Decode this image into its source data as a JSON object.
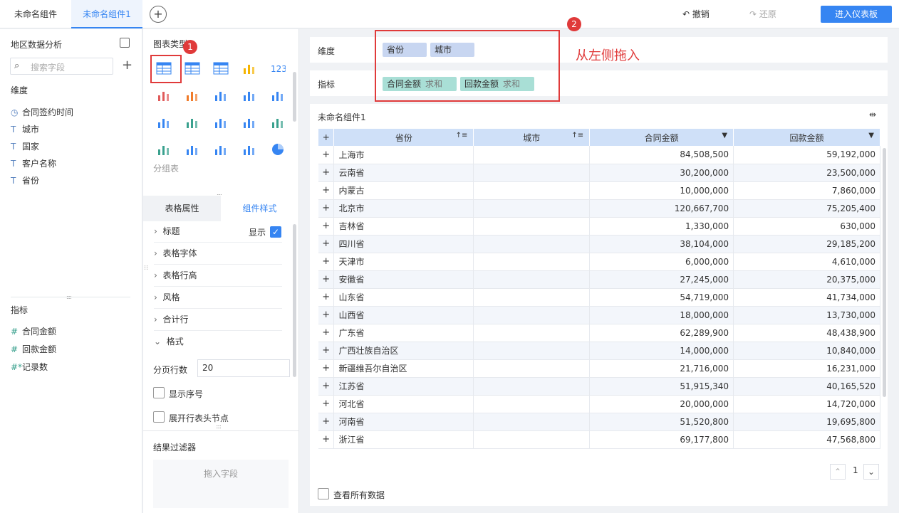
{
  "tabs": [
    "未命名组件",
    "未命名组件1"
  ],
  "toolbar": {
    "undo": "撤销",
    "redo": "还原",
    "enter": "进入仪表板"
  },
  "left": {
    "dataset": "地区数据分析",
    "search_placeholder": "搜索字段",
    "dim_title": "维度",
    "dimensions": [
      {
        "icon": "clock-icon",
        "label": "合同签约时间"
      },
      {
        "icon": "text-icon",
        "label": "城市"
      },
      {
        "icon": "text-icon",
        "label": "国家"
      },
      {
        "icon": "text-icon",
        "label": "客户名称"
      },
      {
        "icon": "text-icon",
        "label": "省份"
      }
    ],
    "ind_title": "指标",
    "indicators": [
      {
        "icon": "hash-icon",
        "label": "合同金额"
      },
      {
        "icon": "hash-icon",
        "label": "回款金额"
      },
      {
        "icon": "hash-star-icon",
        "label": "记录数"
      }
    ]
  },
  "mid": {
    "chart_type_title": "图表类型",
    "group_table_label": "分组表",
    "tabs": [
      "表格属性",
      "组件样式"
    ],
    "props": [
      "标题",
      "表格字体",
      "表格行高",
      "风格",
      "合计行",
      "格式"
    ],
    "show_label": "显示",
    "page_rows_label": "分页行数",
    "page_rows_value": "20",
    "show_index": "显示序号",
    "expand_header": "展开行表头节点",
    "filter_title": "结果过滤器",
    "drop_field": "拖入字段"
  },
  "main": {
    "dim_label": "维度",
    "ind_label": "指标",
    "dim_pills": [
      "省份",
      "城市"
    ],
    "ind_pills": [
      {
        "name": "合同金额",
        "agg": "求和"
      },
      {
        "name": "回款金额",
        "agg": "求和"
      }
    ],
    "annotation": "从左侧拖入",
    "badge1": "1",
    "badge2": "2",
    "component_title": "未命名组件1",
    "columns": [
      "省份",
      "城市",
      "合同金额",
      "回款金额"
    ],
    "rows": [
      [
        "上海市",
        "84,508,500",
        "59,192,000"
      ],
      [
        "云南省",
        "30,200,000",
        "23,500,000"
      ],
      [
        "内蒙古",
        "10,000,000",
        "7,860,000"
      ],
      [
        "北京市",
        "120,667,700",
        "75,205,400"
      ],
      [
        "吉林省",
        "1,330,000",
        "630,000"
      ],
      [
        "四川省",
        "38,104,000",
        "29,185,200"
      ],
      [
        "天津市",
        "6,000,000",
        "4,610,000"
      ],
      [
        "安徽省",
        "27,245,000",
        "20,375,000"
      ],
      [
        "山东省",
        "54,719,000",
        "41,734,000"
      ],
      [
        "山西省",
        "18,000,000",
        "13,730,000"
      ],
      [
        "广东省",
        "62,289,900",
        "48,438,900"
      ],
      [
        "广西壮族自治区",
        "14,000,000",
        "10,840,000"
      ],
      [
        "新疆维吾尔自治区",
        "21,716,000",
        "16,231,000"
      ],
      [
        "江苏省",
        "51,915,340",
        "40,165,520"
      ],
      [
        "河北省",
        "20,000,000",
        "14,720,000"
      ],
      [
        "河南省",
        "51,520,800",
        "19,695,800"
      ],
      [
        "浙江省",
        "69,177,800",
        "47,568,800"
      ]
    ],
    "page": "1",
    "view_all": "查看所有数据"
  }
}
